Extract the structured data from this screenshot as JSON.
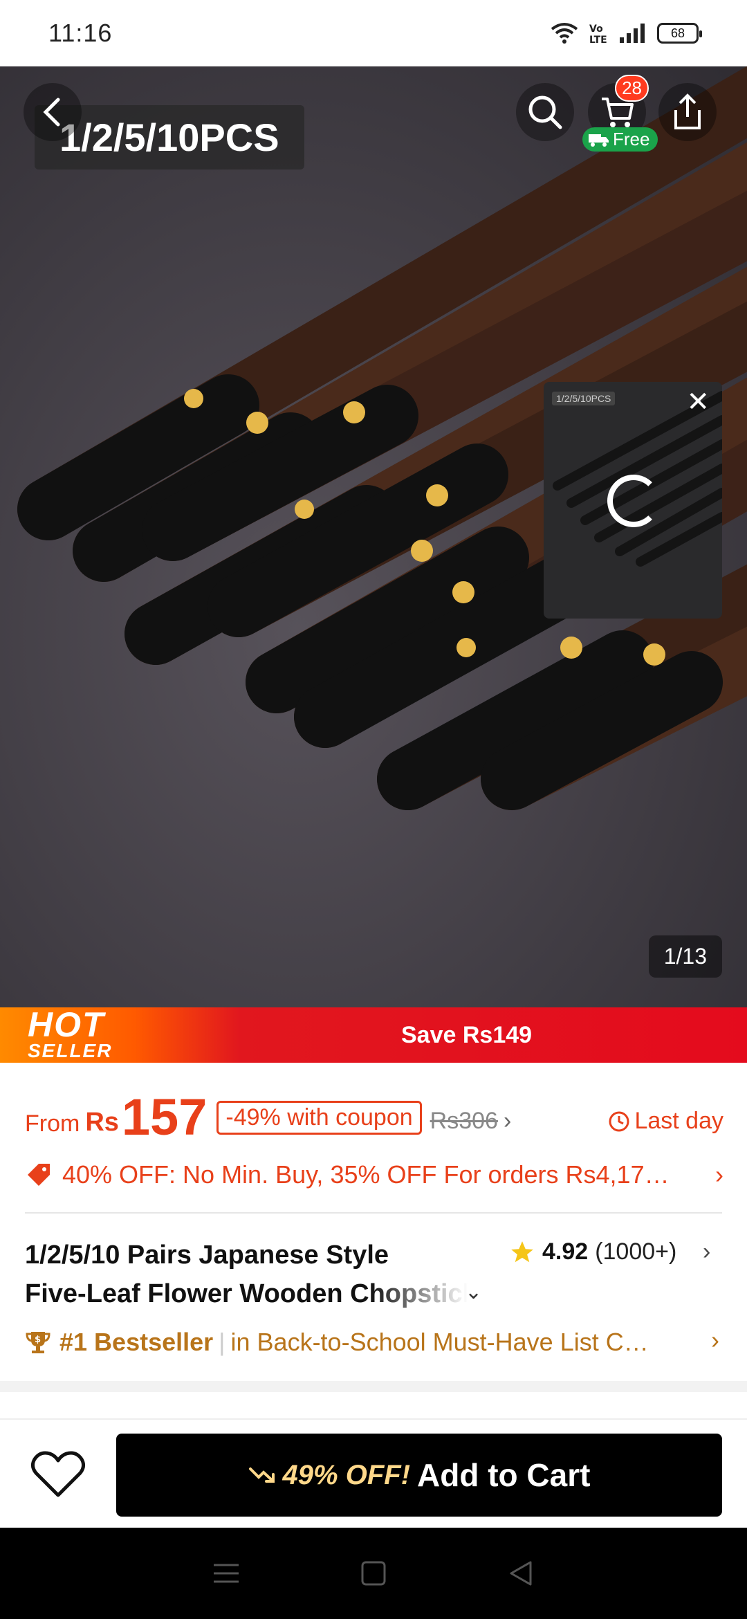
{
  "status_bar": {
    "time": "11:16",
    "battery": "68"
  },
  "hero": {
    "caption": "1/2/5/10PCS",
    "cart_count": "28",
    "free_label": "Free",
    "mini_player_label": "1/2/5/10PCS",
    "image_counter": "1/13"
  },
  "banner": {
    "hot": "HOT",
    "seller": "SELLER",
    "save_text": "Save Rs149"
  },
  "price": {
    "from": "From",
    "currency": "Rs",
    "amount": "157",
    "coupon": "-49% with coupon",
    "old_price": "Rs306",
    "last_day": "Last day"
  },
  "promo": {
    "text": "40% OFF: No Min. Buy,  35% OFF For orders Rs4,17…"
  },
  "product": {
    "title_line1": "1/2/5/10 Pairs Japanese Style",
    "title_line2": "Five-Leaf Flower Wooden Chopsticks",
    "rating": "4.92",
    "review_count": "(1000+)"
  },
  "bestseller": {
    "rank": "#1 Bestseller",
    "category": "in Back-to-School Must-Have List C…"
  },
  "action_bar": {
    "discount": "49% OFF!",
    "add_to_cart": "Add to Cart"
  },
  "colors": {
    "accent": "#e8401a",
    "bestseller": "#b8741a",
    "free_green": "#1aa34a",
    "badge_red": "#ff3b1f"
  }
}
